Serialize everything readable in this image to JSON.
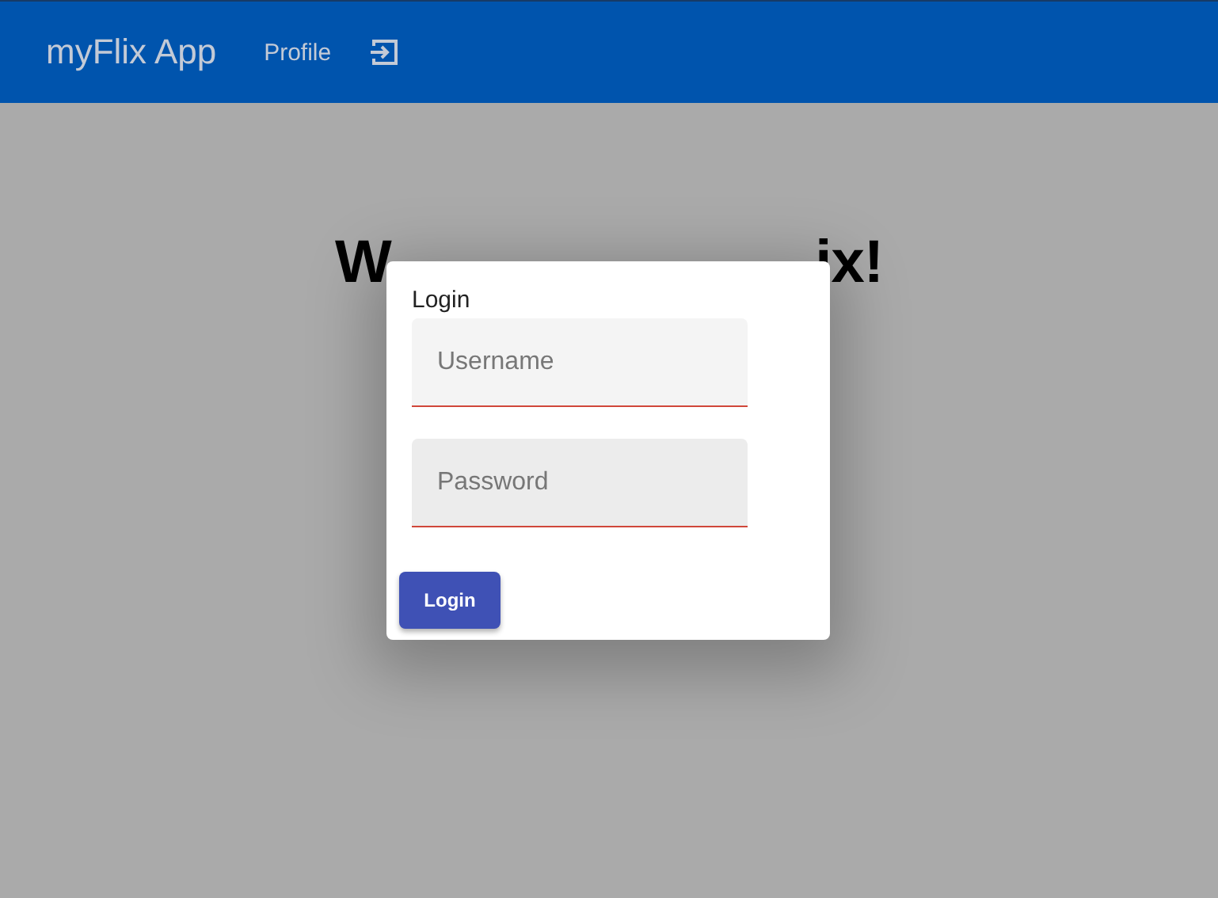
{
  "navbar": {
    "brand": "myFlix App",
    "links": [
      {
        "label": "Profile",
        "kind": "text"
      },
      {
        "kind": "logout-icon"
      }
    ]
  },
  "heading_fragments": [
    "W",
    "ix!"
  ],
  "dialog": {
    "title": "Login",
    "fields": [
      {
        "placeholder": "Username",
        "kind": "text"
      },
      {
        "placeholder": "Password",
        "kind": "password"
      }
    ],
    "button": "Login"
  }
}
